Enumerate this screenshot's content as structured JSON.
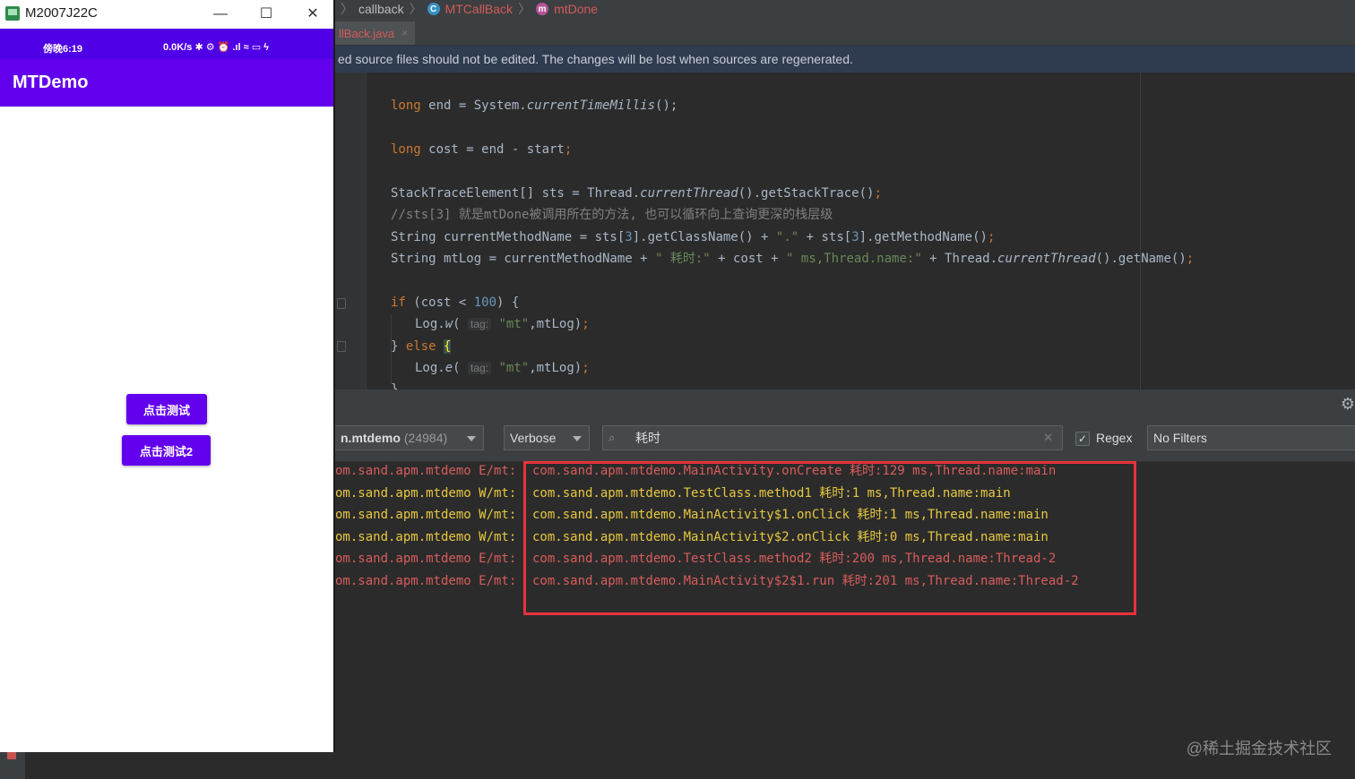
{
  "phone_window": {
    "title": "M2007J22C",
    "minimize": "—",
    "maximize": "☐",
    "close": "✕"
  },
  "status_bar": {
    "time": "傍晚6:19",
    "right": "0.0K/s ✱ ⚙ ⏰ .ıl ≈ ▭ ϟ"
  },
  "app": {
    "title": "MTDemo",
    "button1": "点击测试",
    "button2": "点击测试2"
  },
  "breadcrumb": {
    "items": [
      "callback",
      "MTCallBack",
      "mtDone"
    ],
    "class_icon": "C",
    "method_icon": "m"
  },
  "tab": {
    "file": "llBack.java",
    "close": "×"
  },
  "banner": "ed source files should not be edited. The changes will be lost when sources are regenerated.",
  "code": {
    "l1": "long end = System.currentTimeMillis();",
    "l2": "long cost = end - start;",
    "l3": "StackTraceElement[] sts = Thread.currentThread().getStackTrace();",
    "l4": "//sts[3] 就是mtDone被调用所在的方法, 也可以循环向上查询更深的栈层级",
    "l5": "String currentMethodName = sts[3].getClassName() + \".\" + sts[3].getMethodName();",
    "l6": "String mtLog = currentMethodName + \" 耗时:\" + cost + \" ms,Thread.name:\" + Thread.currentThread().getName();",
    "l7": "if (cost < 100) {",
    "l8": "Log.w( tag: \"mt\",mtLog);",
    "l9": "} else {",
    "l10": "Log.e( tag: \"mt\",mtLog);",
    "l11": "}",
    "hint_tag": "tag:"
  },
  "logcat": {
    "process": "n.mtdemo",
    "pid": "(24984)",
    "level": "Verbose",
    "search": "耗时",
    "regex_label": "Regex",
    "regex_checked": "✓",
    "filter": "No Filters",
    "gear": "⚙",
    "search_clear": "✕",
    "search_icon": "⌕",
    "lines": [
      {
        "prefix": "om.sand.apm.mtdemo E/mt:",
        "msg": "com.sand.apm.mtdemo.MainActivity.onCreate 耗时:129 ms,Thread.name:main",
        "level": "E"
      },
      {
        "prefix": "om.sand.apm.mtdemo W/mt:",
        "msg": "com.sand.apm.mtdemo.TestClass.method1 耗时:1 ms,Thread.name:main",
        "level": "W"
      },
      {
        "prefix": "om.sand.apm.mtdemo W/mt:",
        "msg": "com.sand.apm.mtdemo.MainActivity$1.onClick 耗时:1 ms,Thread.name:main",
        "level": "W"
      },
      {
        "prefix": "om.sand.apm.mtdemo W/mt:",
        "msg": "com.sand.apm.mtdemo.MainActivity$2.onClick 耗时:0 ms,Thread.name:main",
        "level": "W"
      },
      {
        "prefix": "om.sand.apm.mtdemo E/mt:",
        "msg": "com.sand.apm.mtdemo.TestClass.method2 耗时:200 ms,Thread.name:Thread-2",
        "level": "E"
      },
      {
        "prefix": "om.sand.apm.mtdemo E/mt:",
        "msg": "com.sand.apm.mtdemo.MainActivity$2$1.run 耗时:201 ms,Thread.name:Thread-2",
        "level": "E"
      }
    ]
  },
  "watermark": "@稀土掘金技术社区",
  "colors": {
    "app_bar": "#6200ee",
    "status_bar": "#5000e6",
    "log_error": "#d95c5c",
    "log_warn": "#e6c840",
    "highlight_box": "#e8323c"
  }
}
